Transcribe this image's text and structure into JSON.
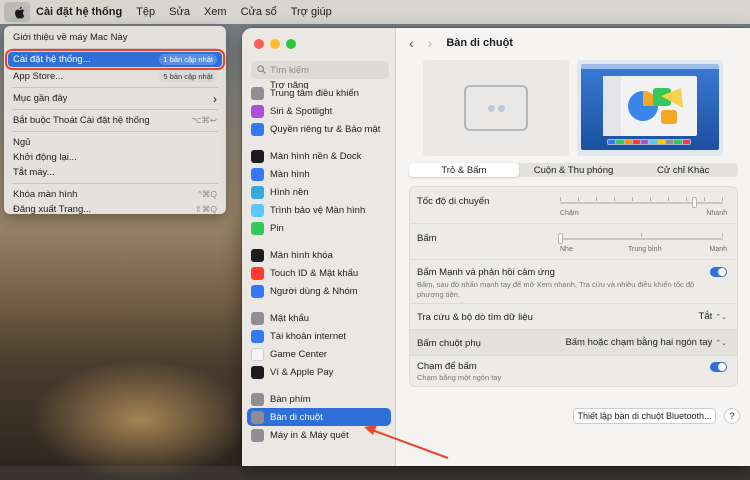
{
  "menubar": {
    "app_name": "Cài đặt hệ thống",
    "items": [
      "Tệp",
      "Sửa",
      "Xem",
      "Cửa sổ",
      "Trợ giúp"
    ]
  },
  "apple_menu": {
    "about": "Giới thiệu về máy Mac Này",
    "settings": "Cài đặt hệ thống...",
    "settings_badge": "1 bản cập nhật",
    "app_store": "App Store...",
    "app_store_badge": "5 bản cập nhật",
    "recent": "Mục gần đây",
    "recent_arrow": "›",
    "force_quit": "Bắt buộc Thoát Cài đặt hệ thống",
    "force_quit_shortcut": "⌥⌘↩",
    "sleep": "Ngủ",
    "restart": "Khởi động lại...",
    "shutdown": "Tắt máy...",
    "lock": "Khóa màn hình",
    "lock_shortcut": "^⌘Q",
    "logout": "Đăng xuất Trang...",
    "logout_shortcut": "⇧⌘Q"
  },
  "sidebar": {
    "search_placeholder": "Tìm kiếm",
    "partial_item": "Trợ năng",
    "items": [
      {
        "label": "Trung tâm điều khiển",
        "icon": "control-center-icon",
        "color": "#8e8e93"
      },
      {
        "label": "Siri & Spotlight",
        "icon": "siri-icon",
        "color": "#b14ddb"
      },
      {
        "label": "Quyền riêng tư & Bảo mật",
        "icon": "privacy-hand-icon",
        "color": "#3478f6"
      },
      {
        "label": "Màn hình nền & Dock",
        "icon": "desktop-dock-icon",
        "color": "#1d1d1f"
      },
      {
        "label": "Màn hình",
        "icon": "display-icon",
        "color": "#3478f6"
      },
      {
        "label": "Hình nền",
        "icon": "wallpaper-icon",
        "color": "#35aadc"
      },
      {
        "label": "Trình bảo vệ Màn hình",
        "icon": "screensaver-icon",
        "color": "#5ac8fa"
      },
      {
        "label": "Pin",
        "icon": "battery-icon",
        "color": "#34c759"
      },
      {
        "label": "Màn hình khóa",
        "icon": "lock-screen-icon",
        "color": "#1d1d1f"
      },
      {
        "label": "Touch ID & Mật khẩu",
        "icon": "fingerprint-icon",
        "color": "#ff3b30"
      },
      {
        "label": "Người dùng & Nhóm",
        "icon": "users-icon",
        "color": "#3478f6"
      },
      {
        "label": "Mật khẩu",
        "icon": "key-icon",
        "color": "#8e8e93"
      },
      {
        "label": "Tài khoản internet",
        "icon": "at-icon",
        "color": "#3478f6"
      },
      {
        "label": "Game Center",
        "icon": "game-center-icon",
        "color": "#f5f5f5"
      },
      {
        "label": "Ví & Apple Pay",
        "icon": "wallet-icon",
        "color": "#1d1d1f"
      },
      {
        "label": "Bàn phím",
        "icon": "keyboard-icon",
        "color": "#8e8e93"
      },
      {
        "label": "Bàn di chuột",
        "icon": "trackpad-icon",
        "color": "#8e8e93"
      },
      {
        "label": "Máy in & Máy quét",
        "icon": "printer-icon",
        "color": "#8e8e93"
      }
    ]
  },
  "main": {
    "title": "Bàn di chuột",
    "back": "‹",
    "forward": "›",
    "tabs": [
      "Trỏ & Bấm",
      "Cuộn & Thu phóng",
      "Cử chỉ Khác"
    ],
    "tracking_speed": {
      "label": "Tốc độ di chuyển",
      "min": "Chậm",
      "max": "Nhanh",
      "value": 0.82
    },
    "click": {
      "label": "Bấm",
      "min": "Nhẹ",
      "mid": "Trung bình",
      "max": "Mạnh",
      "value": 0.0
    },
    "force_click": {
      "label": "Bấm Mạnh và phản hồi cảm ứng",
      "desc": "Bấm, sau đó nhấn mạnh tay để mở Xem nhanh, Tra cứu và nhiều điều khiển tốc độ phương tiện.",
      "on": true
    },
    "lookup": {
      "label": "Tra cứu & bộ dò tìm dữ liệu",
      "value": "Tắt"
    },
    "secondary_click": {
      "label": "Bấm chuột phụ",
      "value": "Bấm hoặc chạm bằng hai ngón tay"
    },
    "tap_to_click": {
      "label": "Chạm để bấm",
      "desc": "Chạm bằng một ngón tay",
      "on": true
    },
    "bluetooth_button": "Thiết lập bàn di chuột Bluetooth...",
    "help": "?"
  },
  "colors": {
    "accent": "#2e6fd8",
    "highlight_box": "#e8452c"
  }
}
